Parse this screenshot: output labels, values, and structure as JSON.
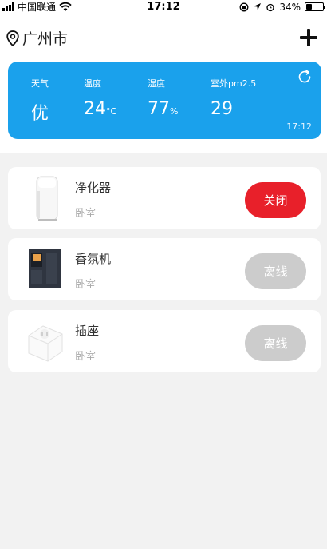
{
  "status_bar": {
    "carrier": "中国联通",
    "time": "17:12",
    "battery": "34%",
    "battery_level": 0.34
  },
  "header": {
    "city": "广州市",
    "location_icon": "location-pin-icon",
    "add_icon": "plus-icon"
  },
  "weather": {
    "labels": {
      "weather": "天气",
      "temperature": "温度",
      "humidity": "湿度",
      "pm25": "室外pm2.5"
    },
    "values": {
      "weather": "优",
      "temperature": "24",
      "temperature_unit": "°C",
      "humidity": "77",
      "humidity_unit": "%",
      "pm25": "29"
    },
    "updated_time": "17:12",
    "refresh_icon": "refresh-icon",
    "color": "#1aa1ec"
  },
  "devices": [
    {
      "name": "净化器",
      "room": "卧室",
      "action": "关闭",
      "status": "online",
      "icon": "air-purifier-image",
      "color": "#e8202a"
    },
    {
      "name": "香氛机",
      "room": "卧室",
      "action": "离线",
      "status": "offline",
      "icon": "aroma-diffuser-image",
      "color": "#cccccc"
    },
    {
      "name": "插座",
      "room": "卧室",
      "action": "离线",
      "status": "offline",
      "icon": "smart-plug-image",
      "color": "#cccccc"
    }
  ]
}
